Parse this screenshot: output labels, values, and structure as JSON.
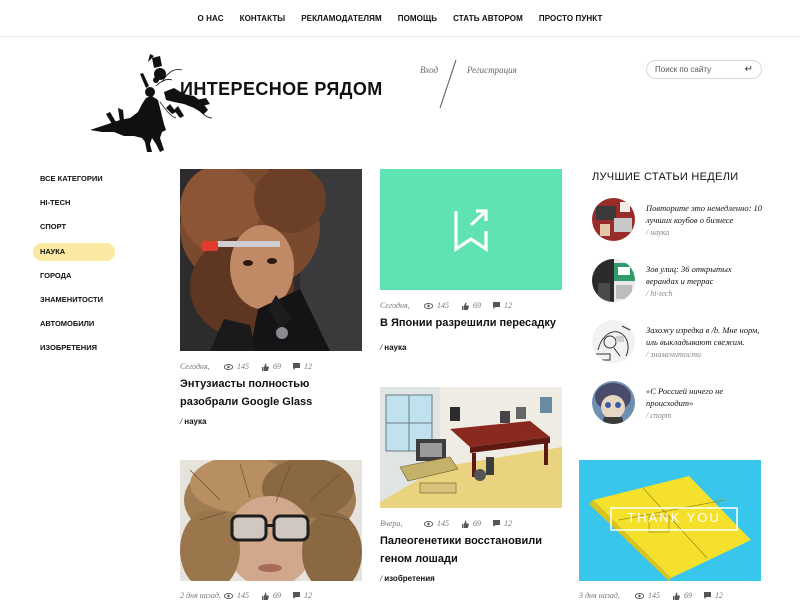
{
  "nav": [
    "О НАС",
    "КОНТАКТЫ",
    "РЕКЛАМОДАТЕЛЯМ",
    "ПОМОЩЬ",
    "СТАТЬ АВТОРОМ",
    "ПРОСТО ПУНКТ"
  ],
  "brand": "ИНТЕРЕСНОЕ РЯДОМ",
  "auth": {
    "login": "Вход",
    "register": "Регистрация"
  },
  "search": {
    "placeholder": "Поиск по сайту",
    "enter_icon": "↵"
  },
  "sidebar": [
    "ВСЕ КАТЕГОРИИ",
    "HI-TECH",
    "СПОРТ",
    "НАУКА",
    "ГОРОДА",
    "ЗНАМЕНИТОСТИ",
    "АВТОМОБИЛИ",
    "ИЗОБРЕТЕНИЯ"
  ],
  "sidebar_active": "НАУКА",
  "colors": {
    "active_bg": "#fbe8a2",
    "teal_card": "#5fe3b0",
    "blue_card": "#38c6ec",
    "yellow_book": "#f5e12b"
  },
  "cards": [
    {
      "date": "Сегодня,",
      "views": "145",
      "likes": "69",
      "comments": "12",
      "title_l1": "Энтузиасты полностью",
      "title_l2": "разобрали Google Glass",
      "category": "наука"
    },
    {
      "date": "Сегодня,",
      "views": "145",
      "likes": "69",
      "comments": "12",
      "title_l1": "В Японии разрешили пересадку",
      "category": "наука"
    },
    {
      "date": "Вчера,",
      "views": "145",
      "likes": "69",
      "comments": "12",
      "title_l1": "Палеогенетики восстановили",
      "title_l2": "геном лошади",
      "category": "изобретения"
    },
    {
      "date": "2 дня назад,",
      "views": "145",
      "likes": "69",
      "comments": "12"
    },
    {
      "date": "3 дня назад,",
      "views": "145",
      "likes": "69",
      "comments": "12",
      "image_text": "THANK YOU"
    }
  ],
  "weekly": {
    "heading": "ЛУЧШИЕ СТАТЬИ НЕДЕЛИ",
    "items": [
      {
        "title": "Повторите это немедленно: 10 лучших коубов о бизнесе",
        "category": "наука"
      },
      {
        "title": "Зов улиц: 36 открытых верандах и террас",
        "category": "hi-tech"
      },
      {
        "title": "Захожу изредка в /b. Мне норм, иль выкладывают свежим.",
        "category": "знаменитости"
      },
      {
        "title": "«С Россией ничего не происходит»",
        "category": "спорт"
      }
    ]
  }
}
